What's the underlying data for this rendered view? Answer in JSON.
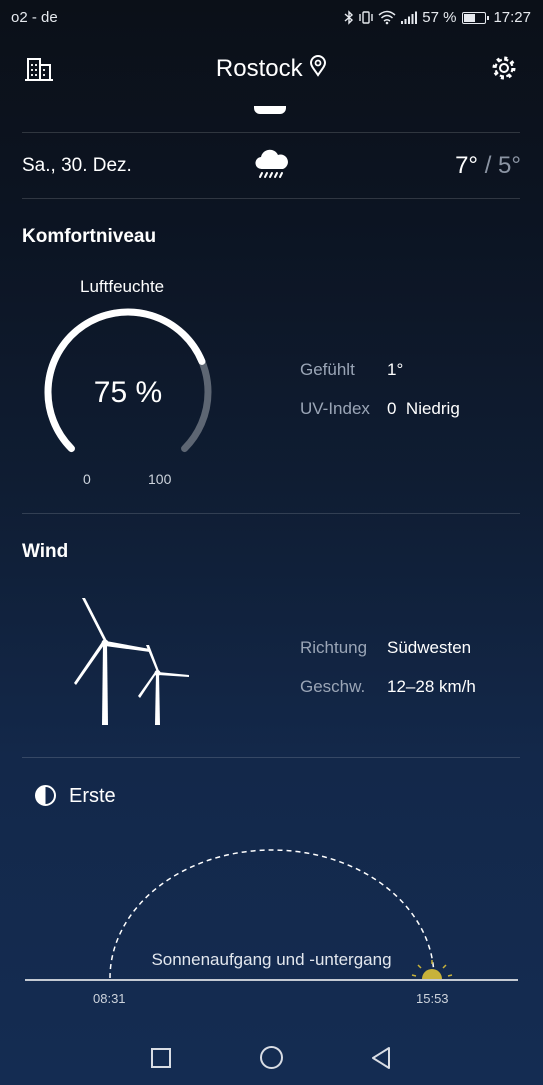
{
  "status_bar": {
    "carrier": "o2 - de",
    "battery": "57 %",
    "battery_level": 0.57,
    "time": "17:27"
  },
  "header": {
    "city": "Rostock",
    "icons": [
      "buildings-icon",
      "location-pin-icon",
      "settings-gear-icon"
    ]
  },
  "forecast": {
    "day": "Sa., 30. Dez.",
    "condition_icon": "rain-cloud-icon",
    "high": "7°",
    "separator": "/",
    "low": "5°"
  },
  "comfort": {
    "title": "Komfortniveau",
    "humidity_label": "Luftfeuchte",
    "humidity_value": "75 %",
    "humidity_percent": 75,
    "gauge_min": "0",
    "gauge_max": "100",
    "felt_label": "Gefühlt",
    "felt_value": "1°",
    "uv_label": "UV-Index",
    "uv_value": "0",
    "uv_text": "Niedrig"
  },
  "wind": {
    "title": "Wind",
    "icon": "wind-turbines-icon",
    "direction_label": "Richtung",
    "direction_value": "Südwesten",
    "speed_label": "Geschw.",
    "speed_value": "12–28 km/h"
  },
  "moon": {
    "icon": "half-moon-icon",
    "phase": "Erste"
  },
  "sun": {
    "caption": "Sonnenaufgang und -untergang",
    "sunrise": "08:31",
    "sunset": "15:53"
  },
  "nav": {
    "icons": [
      "recent-apps-icon",
      "home-icon",
      "back-icon"
    ]
  },
  "colors": {
    "background_top": "#0b1018",
    "background_bottom": "#142c52",
    "muted_text": "#9aa5b6",
    "sun": "#c8b23a"
  }
}
